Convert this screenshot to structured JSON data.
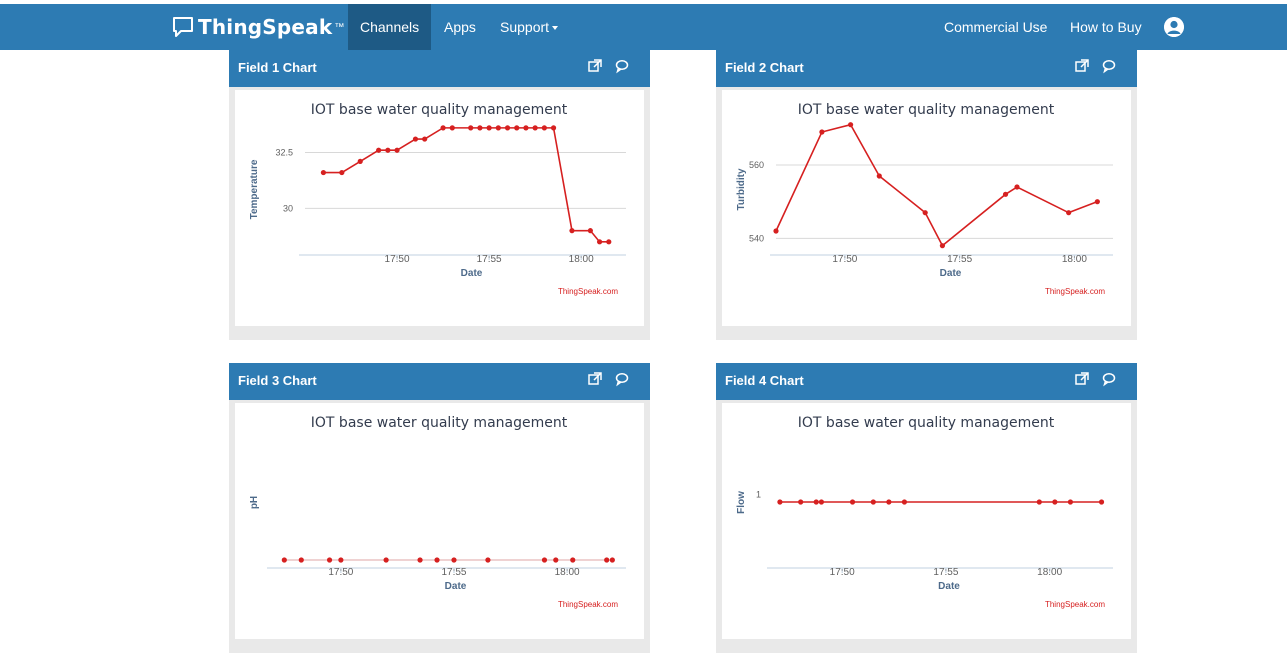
{
  "nav": {
    "brand": "ThingSpeak",
    "brand_tm": "™",
    "items": [
      "Channels",
      "Apps",
      "Support"
    ],
    "right_items": [
      "Commercial Use",
      "How to Buy"
    ],
    "icons": {
      "brand": "chat-bubble-icon",
      "support_caret": "caret-down-icon",
      "account": "user-avatar-icon",
      "popout": "external-link-icon",
      "comment": "comment-icon"
    },
    "colors": {
      "navbar": "#2d7bb3",
      "active": "#1e5a85",
      "series": "#d62020"
    }
  },
  "charts": [
    {
      "panel_title": "Field 1 Chart",
      "chart_data": {
        "type": "line",
        "title": "IOT base water quality management",
        "xlabel": "Date",
        "ylabel": "Temperature",
        "credit": "ThingSpeak.com",
        "x_ticks": [
          "17:50",
          "17:55",
          "18:00"
        ],
        "y_ticks": [
          "32.5",
          "30"
        ],
        "grid": true,
        "series": [
          {
            "x": [
              "17:46:00",
              "17:47:00",
              "17:48:00",
              "17:49:00",
              "17:49:30",
              "17:50:00",
              "17:51:00",
              "17:51:30",
              "17:52:30",
              "17:53:00",
              "17:54:00",
              "17:54:30",
              "17:55:00",
              "17:55:30",
              "17:56:00",
              "17:56:30",
              "17:57:00",
              "17:57:30",
              "17:58:00",
              "17:58:30",
              "17:59:30",
              "18:00:30",
              "18:01:00",
              "18:01:30"
            ],
            "y": [
              31.6,
              31.6,
              32.1,
              32.6,
              32.6,
              32.6,
              33.1,
              33.1,
              33.6,
              33.6,
              33.6,
              33.6,
              33.6,
              33.6,
              33.6,
              33.6,
              33.6,
              33.6,
              33.6,
              33.6,
              29.0,
              29.0,
              28.5,
              28.5
            ]
          }
        ]
      }
    },
    {
      "panel_title": "Field 2 Chart",
      "chart_data": {
        "type": "line",
        "title": "IOT base water quality management",
        "xlabel": "Date",
        "ylabel": "Turbidity",
        "credit": "ThingSpeak.com",
        "x_ticks": [
          "17:50",
          "17:55",
          "18:00"
        ],
        "y_ticks": [
          "560",
          "540"
        ],
        "grid": true,
        "series": [
          {
            "x": [
              "17:47:00",
              "17:49:00",
              "17:50:15",
              "17:51:30",
              "17:53:30",
              "17:54:15",
              "17:57:00",
              "17:57:30",
              "17:59:45",
              "18:01:00"
            ],
            "y": [
              542,
              569,
              571,
              557,
              547,
              538,
              552,
              554,
              547,
              550
            ]
          }
        ]
      }
    },
    {
      "panel_title": "Field 3 Chart",
      "chart_data": {
        "type": "line",
        "title": "IOT base water quality management",
        "xlabel": "Date",
        "ylabel": "pH",
        "credit": "ThingSpeak.com",
        "x_ticks": [
          "17:50",
          "17:55",
          "18:00"
        ],
        "y_ticks": [],
        "grid": false,
        "series": [
          {
            "x": [
              "17:47:30",
              "17:48:15",
              "17:49:30",
              "17:50:00",
              "17:52:00",
              "17:53:30",
              "17:54:15",
              "17:55:00",
              "17:56:30",
              "17:59:00",
              "17:59:30",
              "18:00:15",
              "18:01:45",
              "18:02:00"
            ],
            "y": [
              0,
              0,
              0,
              0,
              0,
              0,
              0,
              0,
              0,
              0,
              0,
              0,
              0,
              0
            ]
          }
        ]
      }
    },
    {
      "panel_title": "Field 4 Chart",
      "chart_data": {
        "type": "line",
        "title": "IOT base water quality management",
        "xlabel": "Date",
        "ylabel": "Flow",
        "credit": "ThingSpeak.com",
        "x_ticks": [
          "17:50",
          "17:55",
          "18:00"
        ],
        "y_ticks": [
          "1"
        ],
        "grid": false,
        "series": [
          {
            "x": [
              "17:47:00",
              "17:48:00",
              "17:48:45",
              "17:49:00",
              "17:50:30",
              "17:51:30",
              "17:52:15",
              "17:53:00",
              "17:59:30",
              "18:00:15",
              "18:01:00",
              "18:02:30"
            ],
            "y": [
              1,
              1,
              1,
              1,
              1,
              1,
              1,
              1,
              1,
              1,
              1,
              1
            ]
          }
        ]
      }
    }
  ]
}
